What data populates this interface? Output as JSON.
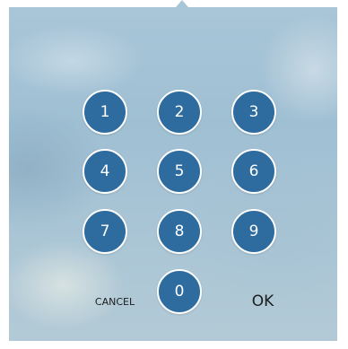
{
  "keypad": {
    "digits": [
      "1",
      "2",
      "3",
      "4",
      "5",
      "6",
      "7",
      "8",
      "9",
      "0"
    ],
    "cancel_label": "CANCEL",
    "ok_label": "OK"
  },
  "colors": {
    "key_fill": "#2e6c9f",
    "key_border": "#ffffff",
    "background": "#a9c6d8"
  }
}
